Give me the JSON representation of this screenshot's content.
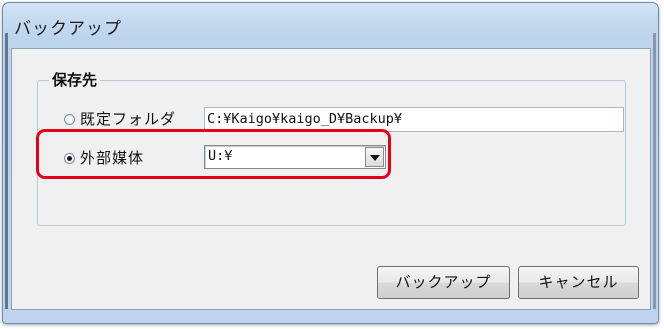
{
  "window": {
    "title": "バックアップ"
  },
  "destination_group": {
    "label": "保存先",
    "options": [
      {
        "label": "既定フォルダ",
        "value": "C:¥Kaigo¥kaigo_D¥Backup¥",
        "selected": false
      },
      {
        "label": "外部媒体",
        "value": "U:¥",
        "selected": true
      }
    ]
  },
  "buttons": {
    "backup": "バックアップ",
    "cancel": "キャンセル"
  },
  "colors": {
    "highlight": "#e6001a",
    "window_frame": "#bcd3ec"
  }
}
